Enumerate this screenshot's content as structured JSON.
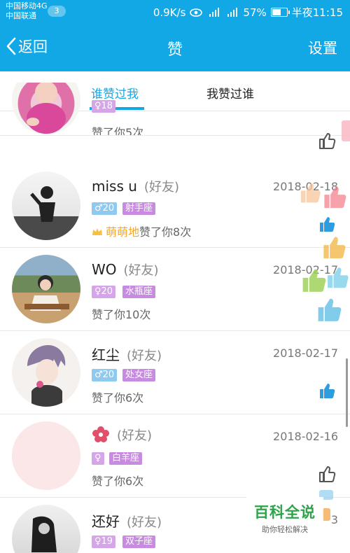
{
  "status_bar": {
    "carrier1": "中国移动4G",
    "carrier2": "中国联通",
    "notification_count": "3",
    "net_speed": "0.9K/s",
    "battery": "57%",
    "time": "半夜11:15"
  },
  "nav": {
    "back_label": "返回",
    "title": "赞",
    "settings_label": "设置"
  },
  "tabs": [
    {
      "label": "谁赞过我",
      "active": true
    },
    {
      "label": "我赞过谁",
      "active": false
    }
  ],
  "friend_tag": "(好友)",
  "rows": [
    {
      "name": "",
      "gender_symbol": "♀",
      "age": "18",
      "zodiac": "",
      "date": "",
      "like_text": "赞了你5次",
      "liker_nick": ""
    },
    {
      "name": "miss  u",
      "gender_symbol": "♂",
      "age": "20",
      "zodiac": "射手座",
      "date": "2018-02-18",
      "like_text": "赞了你8次",
      "liker_nick": "萌萌地"
    },
    {
      "name": "WO",
      "gender_symbol": "♀",
      "age": "20",
      "zodiac": "水瓶座",
      "date": "2018-02-17",
      "like_text": "赞了你10次",
      "liker_nick": ""
    },
    {
      "name": "红尘",
      "gender_symbol": "♂",
      "age": "20",
      "zodiac": "处女座",
      "date": "2018-02-17",
      "like_text": "赞了你6次",
      "liker_nick": ""
    },
    {
      "name": "",
      "gender_symbol": "♀",
      "age": "",
      "zodiac": "白羊座",
      "date": "2018-02-16",
      "like_text": "赞了你6次",
      "liker_nick": ""
    },
    {
      "name": "还好",
      "gender_symbol": "♀",
      "age": "19",
      "zodiac": "双子座",
      "date": "",
      "like_text": "",
      "liker_nick": ""
    }
  ],
  "partial_date_digit": "3",
  "watermark": {
    "title": "百科全说",
    "subtitle": "助你轻松解决"
  },
  "colors": {
    "accent": "#12a8e6",
    "zodiac": "#c78be0",
    "male": "#8ec9f0",
    "female": "#d5a4e9",
    "nick": "#f5a623"
  }
}
